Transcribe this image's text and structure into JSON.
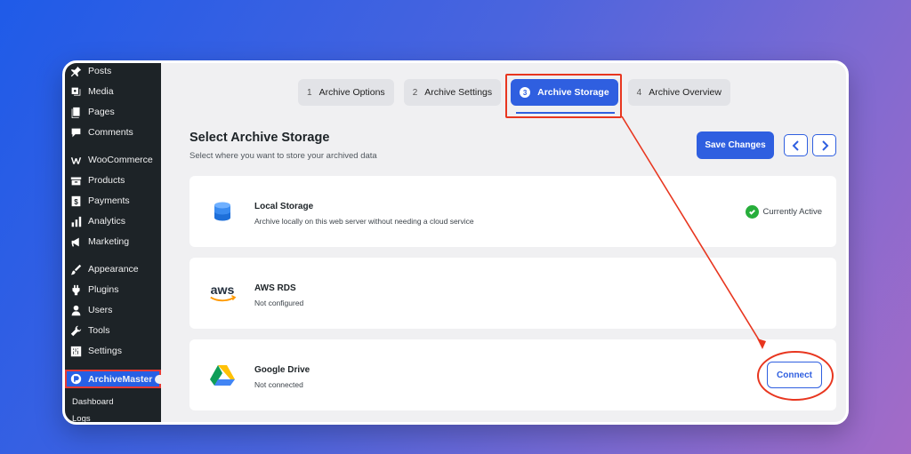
{
  "sidebar": {
    "items": [
      {
        "label": "Posts",
        "icon": "pin-icon"
      },
      {
        "label": "Media",
        "icon": "media-icon"
      },
      {
        "label": "Pages",
        "icon": "pages-icon"
      },
      {
        "label": "Comments",
        "icon": "comments-icon"
      },
      {
        "label": "WooCommerce",
        "icon": "woocommerce-icon"
      },
      {
        "label": "Products",
        "icon": "products-icon"
      },
      {
        "label": "Payments",
        "icon": "payments-icon"
      },
      {
        "label": "Analytics",
        "icon": "analytics-icon"
      },
      {
        "label": "Marketing",
        "icon": "marketing-icon"
      },
      {
        "label": "Appearance",
        "icon": "appearance-icon"
      },
      {
        "label": "Plugins",
        "icon": "plugins-icon"
      },
      {
        "label": "Users",
        "icon": "users-icon"
      },
      {
        "label": "Tools",
        "icon": "tools-icon"
      },
      {
        "label": "Settings",
        "icon": "settings-icon"
      }
    ],
    "active_item": {
      "label": "ArchiveMaster",
      "icon": "archivemaster-icon"
    },
    "sub_items": [
      "Dashboard",
      "Logs"
    ]
  },
  "tabs": [
    {
      "number": "1",
      "label": "Archive Options"
    },
    {
      "number": "2",
      "label": "Archive Settings"
    },
    {
      "number": "3",
      "label": "Archive Storage"
    },
    {
      "number": "4",
      "label": "Archive Overview"
    }
  ],
  "header": {
    "title": "Select Archive Storage",
    "subtitle": "Select where you want to store your archived data",
    "save_label": "Save Changes"
  },
  "storage": [
    {
      "title": "Local Storage",
      "desc": "Archive locally on this web server without needing a cloud service",
      "status": "Currently Active",
      "icon": "database-icon"
    },
    {
      "title": "AWS RDS",
      "desc": "Not configured",
      "icon": "aws-logo"
    },
    {
      "title": "Google Drive",
      "desc": "Not connected",
      "action": "Connect",
      "icon": "google-drive-icon"
    }
  ],
  "colors": {
    "accent": "#2f5fe0",
    "sidebar_bg": "#1d2327",
    "highlight": "#e8361f",
    "success": "#27ae3b"
  }
}
